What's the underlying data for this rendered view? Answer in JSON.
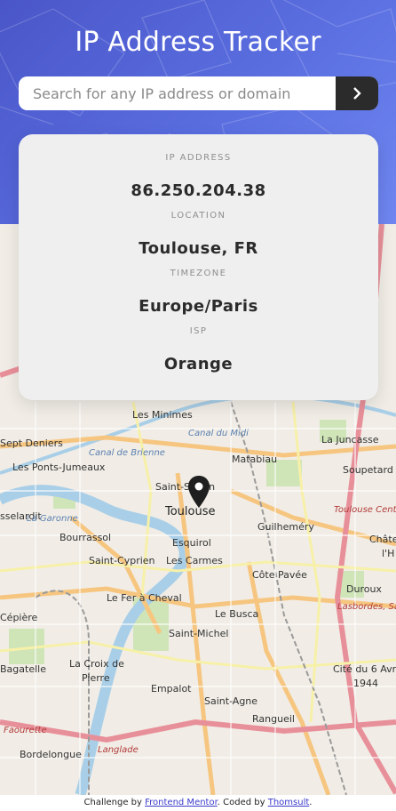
{
  "header": {
    "title": "IP Address Tracker",
    "search_placeholder": "Search for any IP address or domain",
    "search_value": "",
    "submit_icon": "chevron-right-icon"
  },
  "info": {
    "ip_label": "IP ADDRESS",
    "ip_value": "86.250.204.38",
    "location_label": "LOCATION",
    "location_value": "Toulouse, FR",
    "timezone_label": "TIMEZONE",
    "timezone_value": "Europe/Paris",
    "isp_label": "ISP",
    "isp_value": "Orange"
  },
  "map": {
    "marker_icon": "location-pin-icon",
    "labels": {
      "les_minimes": "Les Minimes",
      "sept_deniers": "Sept Deniers",
      "la_juncasse": "La Juncasse",
      "les_ponts_jumeaux": "Les Ponts-Jumeaux",
      "matabiau": "Matabiau",
      "soupetard": "Soupetard",
      "saint_sernin": "Saint-Sernin",
      "toulouse": "Toulouse",
      "toulouse_centre": "Toulouse Centre",
      "seilardit": "sselardit",
      "bourrassol": "Bourrassol",
      "esquirol": "Esquirol",
      "guilhemery": "Guilheméry",
      "chateau": "Châte",
      "l_h": "l'H",
      "saint_cyprien": "Saint-Cyprien",
      "les_carmes": "Les Carmes",
      "cote_pavee": "Côte Pavée",
      "duroux": "Duroux",
      "le_fer_a_cheval": "Le Fer à Cheval",
      "lasbordes": "Lasbordes, Sab",
      "cepiere": "Cépière",
      "le_busca": "Le Busca",
      "saint_michel": "Saint-Michel",
      "bagatelle": "Bagatelle",
      "la_croix_de_pierre_1": "La Croix de",
      "la_croix_de_pierre_2": "Pierre",
      "cite_du_6_avril_1": "Cité du 6 Avr",
      "cite_du_6_avril_2": "1944",
      "empalot": "Empalot",
      "saint_agne": "Saint-Agne",
      "rangueil": "Rangueil",
      "bordelongue": "Bordelongue",
      "langlade": "Langlade",
      "faourette": "Faourette",
      "canal_du_midi": "Canal du Midi",
      "la_garonne": "La Garonne",
      "canal_de_brienne": "Canal de Brienne"
    }
  },
  "footer": {
    "text_1": "Challenge by ",
    "link_1": "Frontend Mentor",
    "text_2": ". Coded by ",
    "link_2": "Thomsult",
    "text_3": "."
  },
  "colors": {
    "hero_start": "#4a56c8",
    "hero_end": "#6f86f0",
    "button_dark": "#2b2b2b",
    "card_bg": "#efefef"
  }
}
